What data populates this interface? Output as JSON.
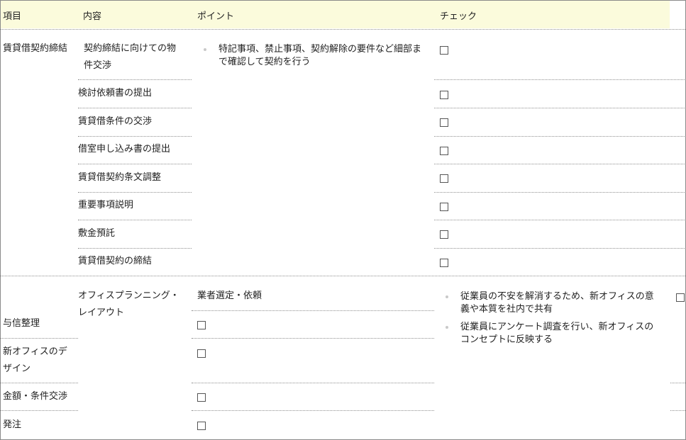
{
  "headers": {
    "item": "項目",
    "content": "内容",
    "point": "ポイント",
    "check": "チェック"
  },
  "section1": {
    "item": "賃貸借契約締結",
    "rows": [
      {
        "label_line1": "契約締結に向けての物",
        "label_line2": "件交渉"
      },
      {
        "label": "検討依頼書の提出"
      },
      {
        "label": "賃貸借条件の交渉"
      },
      {
        "label": "借室申し込み書の提出"
      },
      {
        "label": "賃貸借契約条文調整"
      },
      {
        "label": "重要事項説明"
      },
      {
        "label": "敷金預託"
      },
      {
        "label": "賃貸借契約の締結"
      }
    ],
    "point_line1": "特記事項、禁止事項、契約解除の要件など細部ま",
    "point_line2": "で確認して契約を行う"
  },
  "section2": {
    "item_line1": "オフィスプランニング・",
    "item_line2": "レイアウト",
    "first_content": "業者選定・依頼",
    "rows": [
      {
        "label": "与信整理"
      },
      {
        "label_line1": "新オフィスのデ",
        "label_line2": "ザイン"
      },
      {
        "label": "金額・条件交渉"
      },
      {
        "label": "発注"
      }
    ],
    "points": [
      {
        "line1": "従業員の不安を解消するため、新オフィスの意",
        "line2": "義や本質を社内で共有"
      },
      {
        "line1": "従業員にアンケート調査を行い、新オフィスの",
        "line2": "コンセプトに反映する"
      }
    ]
  },
  "colors": {
    "header_bg": "#fbfbdc",
    "border": "#8a8a8a",
    "dotted_line": "#8f8f8f",
    "bullet": "#c9c9c9"
  }
}
